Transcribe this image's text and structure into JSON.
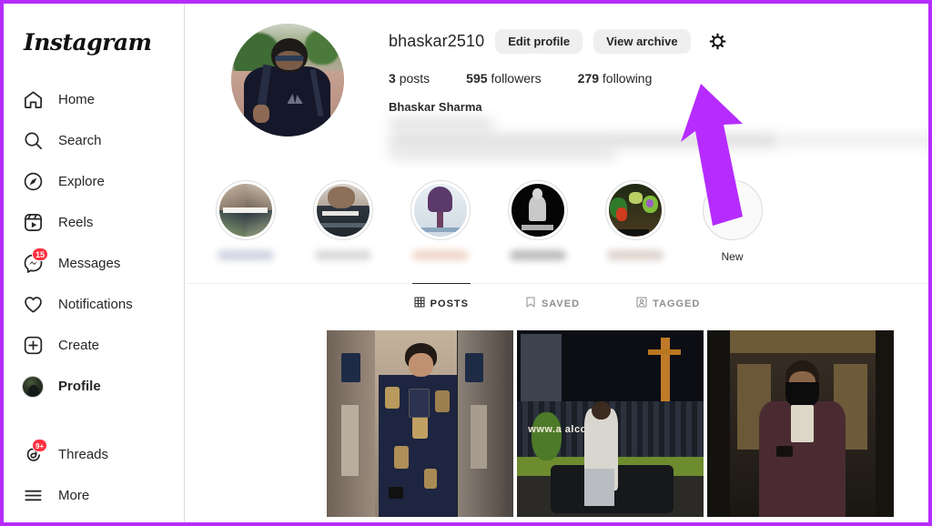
{
  "app": {
    "brand": "Instagram"
  },
  "sidebar": {
    "items": [
      {
        "label": "Home",
        "icon": "home-icon",
        "badge": null,
        "active": false
      },
      {
        "label": "Search",
        "icon": "search-icon",
        "badge": null,
        "active": false
      },
      {
        "label": "Explore",
        "icon": "compass-icon",
        "badge": null,
        "active": false
      },
      {
        "label": "Reels",
        "icon": "reels-icon",
        "badge": null,
        "active": false
      },
      {
        "label": "Messages",
        "icon": "messenger-icon",
        "badge": "15",
        "active": false
      },
      {
        "label": "Notifications",
        "icon": "heart-icon",
        "badge": null,
        "active": false
      },
      {
        "label": "Create",
        "icon": "plus-square-icon",
        "badge": null,
        "active": false
      },
      {
        "label": "Profile",
        "icon": "profile-avatar-icon",
        "badge": null,
        "active": true
      }
    ],
    "footer_items": [
      {
        "label": "Threads",
        "icon": "threads-icon",
        "badge": "9+"
      },
      {
        "label": "More",
        "icon": "hamburger-menu-icon",
        "badge": null
      }
    ]
  },
  "profile": {
    "username": "bhaskar2510",
    "edit_profile_label": "Edit profile",
    "view_archive_label": "View archive",
    "settings_icon": "gear-icon",
    "stats": [
      {
        "value": "3",
        "label": "posts"
      },
      {
        "value": "595",
        "label": "followers"
      },
      {
        "value": "279",
        "label": "following"
      }
    ],
    "full_name": "Bhaskar Sharma",
    "bio_redacted": true
  },
  "highlights": {
    "items": [
      {
        "label_redacted": true,
        "style": "h1"
      },
      {
        "label_redacted": true,
        "style": "h2"
      },
      {
        "label_redacted": true,
        "style": "h3"
      },
      {
        "label_redacted": true,
        "style": "h4"
      },
      {
        "label_redacted": true,
        "style": "h5"
      }
    ],
    "new_label": "New",
    "new_icon": "plus-icon"
  },
  "tabs": [
    {
      "label": "POSTS",
      "icon": "grid-icon",
      "active": true
    },
    {
      "label": "SAVED",
      "icon": "bookmark-icon",
      "active": false
    },
    {
      "label": "TAGGED",
      "icon": "tagged-icon",
      "active": false
    }
  ],
  "posts": [
    {
      "style": "p1",
      "caption_text": ""
    },
    {
      "style": "p2",
      "caption_text": "www.a  alco.com"
    },
    {
      "style": "p3",
      "caption_text": ""
    }
  ],
  "annotation": {
    "type": "arrow",
    "color": "#b62cff",
    "points_to": "279 following"
  },
  "colors": {
    "accent": "#b62cff",
    "badge": "#ff3040",
    "text": "#262626",
    "muted": "#8e8e8e",
    "pill_bg": "#efefef"
  }
}
